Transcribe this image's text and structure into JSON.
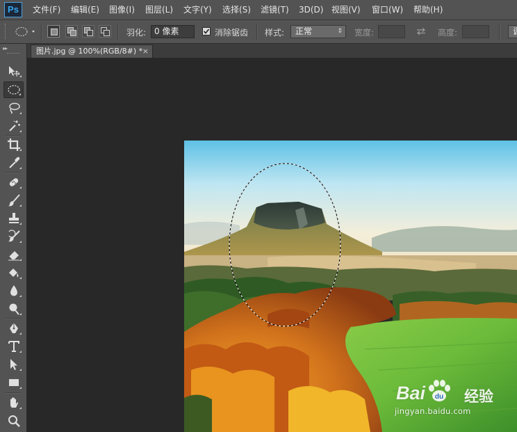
{
  "app": {
    "logo": "Ps"
  },
  "menu": [
    "文件(F)",
    "编辑(E)",
    "图像(I)",
    "图层(L)",
    "文字(Y)",
    "选择(S)",
    "滤镜(T)",
    "3D(D)",
    "视图(V)",
    "窗口(W)",
    "帮助(H)"
  ],
  "options": {
    "feather_label": "羽化:",
    "feather_value": "0 像素",
    "antialias_label": "消除锯齿",
    "antialias_checked": true,
    "style_label": "样式:",
    "style_value": "正常",
    "width_label": "宽度:",
    "width_value": "",
    "height_label": "高度:",
    "height_value": "",
    "refine_edge_button": "调"
  },
  "toolbar": {
    "collapse": "▸▸",
    "tools": [
      "move-icon",
      "elliptical-marquee-icon",
      "lasso-icon",
      "magic-wand-icon",
      "crop-icon",
      "eyedropper-icon",
      "spot-healing-brush-icon",
      "brush-icon",
      "clone-stamp-icon",
      "history-brush-icon",
      "eraser-icon",
      "paint-bucket-icon",
      "blur-icon",
      "dodge-icon",
      "pen-icon",
      "type-icon",
      "path-selection-icon",
      "rectangle-icon",
      "hand-icon",
      "zoom-icon"
    ],
    "active_tool": "elliptical-marquee-icon"
  },
  "document": {
    "tab_title": "图片.jpg @ 100%(RGB/8#) *",
    "tab_close": "×"
  },
  "watermark": {
    "brand": "Bai",
    "brand_tail": "du",
    "cn": "经验",
    "url": "jingyan.baidu.com"
  },
  "colors": {
    "ui_panel": "#535353",
    "canvas_bg": "#282828",
    "ps_blue": "#36a6ee"
  }
}
